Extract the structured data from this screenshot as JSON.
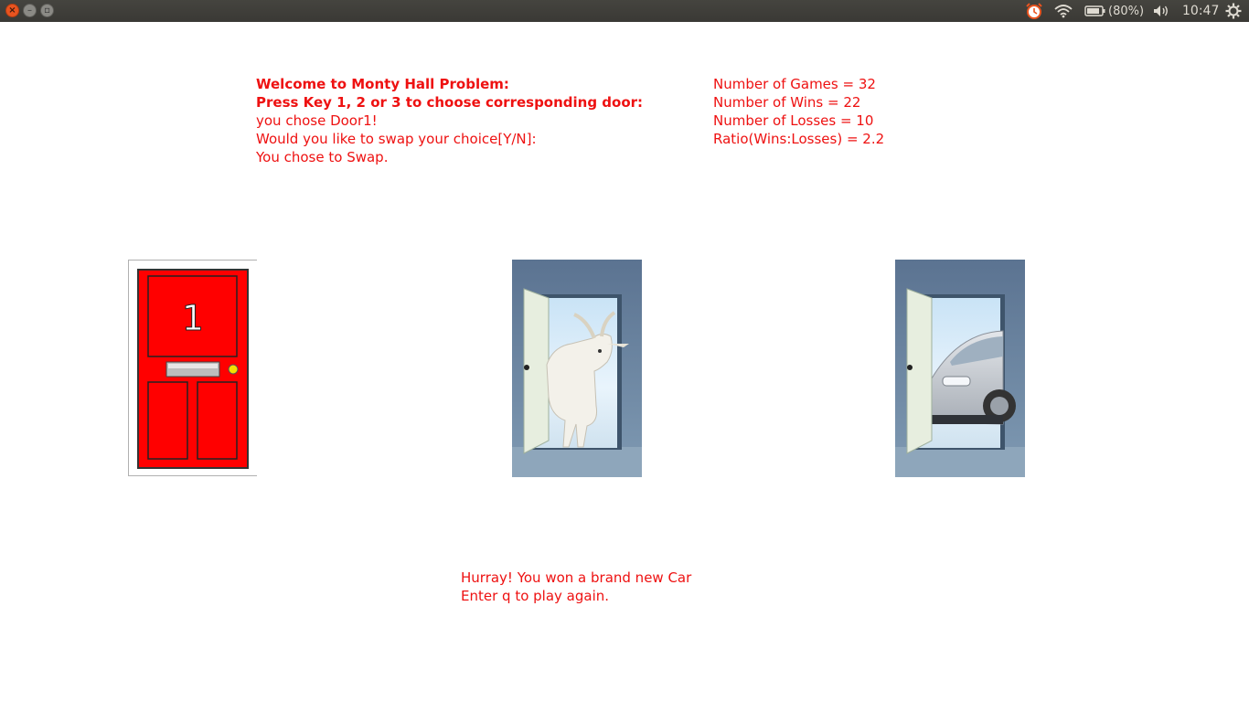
{
  "system_panel": {
    "battery_percent": "(80%)",
    "clock": "10:47"
  },
  "game": {
    "intro_lines": [
      "Welcome to Monty Hall Problem:",
      "Press Key 1, 2 or 3 to choose corresponding door:",
      "you chose Door1!",
      "Would you like to swap your choice[Y/N]:",
      "You chose to Swap."
    ],
    "stats": [
      "Number of Games = 32",
      "Number of Wins = 22",
      "Number of Losses = 10",
      "Ratio(Wins:Losses) = 2.2"
    ],
    "doors": [
      {
        "state": "closed",
        "number": "1",
        "color": "#ff0000"
      },
      {
        "state": "open",
        "reveal": "goat"
      },
      {
        "state": "open",
        "reveal": "car"
      }
    ],
    "result_lines": [
      "Hurray! You won a brand new Car",
      "Enter q to play again."
    ]
  }
}
